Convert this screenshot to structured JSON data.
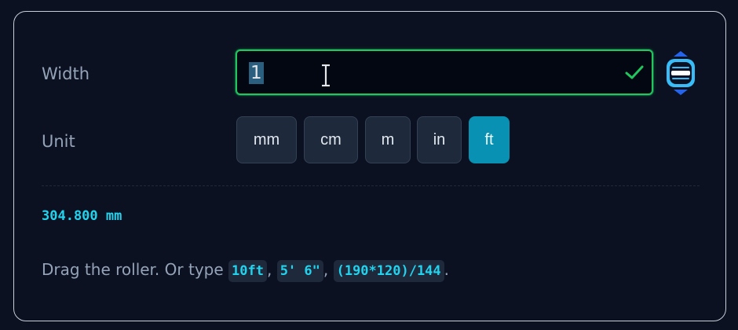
{
  "field": {
    "width_label": "Width",
    "value": "1",
    "valid": true
  },
  "units": {
    "label": "Unit",
    "options": [
      "mm",
      "cm",
      "m",
      "in",
      "ft"
    ],
    "selected": "ft"
  },
  "result": {
    "text": "304.800 mm"
  },
  "help": {
    "prefix": "Drag the roller. Or type ",
    "examples": [
      "10ft",
      "5' 6\"",
      "(190*120)/144"
    ],
    "separator": ", ",
    "suffix": "."
  },
  "colors": {
    "accent": "#0891b2",
    "valid": "#22c55e",
    "result": "#22d3ee"
  },
  "icons": {
    "check": "check-icon",
    "roller": "roller-icon",
    "cursor": "text-cursor-icon"
  }
}
